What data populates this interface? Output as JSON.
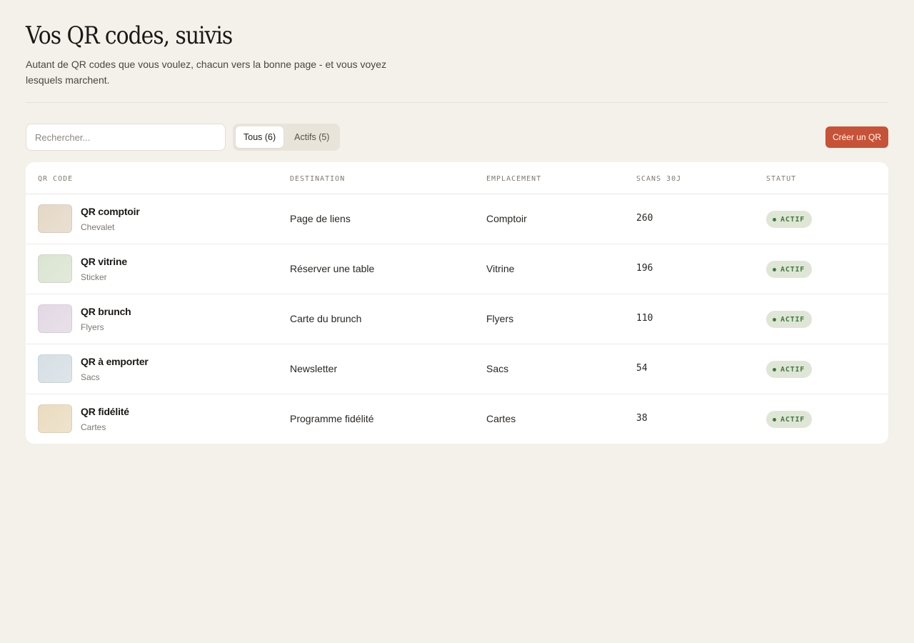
{
  "header": {
    "title": "Vos QR codes, suivis",
    "subtitle": "Autant de QR codes que vous voulez, chacun vers la bonne page - et vous voyez lesquels marchent."
  },
  "toolbar": {
    "search_placeholder": "Rechercher...",
    "tabs": [
      {
        "label": "Tous (6)",
        "active": true
      },
      {
        "label": "Actifs (5)",
        "active": false
      }
    ],
    "create_label": "Créer un QR"
  },
  "table": {
    "columns": [
      "QR CODE",
      "DESTINATION",
      "EMPLACEMENT",
      "SCANS 30J",
      "STATUT"
    ],
    "rows": [
      {
        "name": "QR comptoir",
        "sub": "Chevalet",
        "destination": "Page de liens",
        "location": "Comptoir",
        "scans": "260",
        "status": "ACTIF",
        "thumb_color": "#e4d8c7"
      },
      {
        "name": "QR vitrine",
        "sub": "Sticker",
        "destination": "Réserver une table",
        "location": "Vitrine",
        "scans": "196",
        "status": "ACTIF",
        "thumb_color": "#dbe4d2"
      },
      {
        "name": "QR brunch",
        "sub": "Flyers",
        "destination": "Carte du brunch",
        "location": "Flyers",
        "scans": "110",
        "status": "ACTIF",
        "thumb_color": "#e3d8e4"
      },
      {
        "name": "QR à emporter",
        "sub": "Sacs",
        "destination": "Newsletter",
        "location": "Sacs",
        "scans": "54",
        "status": "ACTIF",
        "thumb_color": "#d6dfe5"
      },
      {
        "name": "QR fidélité",
        "sub": "Cartes",
        "destination": "Programme fidélité",
        "location": "Cartes",
        "scans": "38",
        "status": "ACTIF",
        "thumb_color": "#eadcc0"
      }
    ]
  },
  "colors": {
    "background": "#f4f1ea",
    "accent": "#c75237",
    "status_bg": "#dfe6d6",
    "status_fg": "#3f7a3f"
  }
}
